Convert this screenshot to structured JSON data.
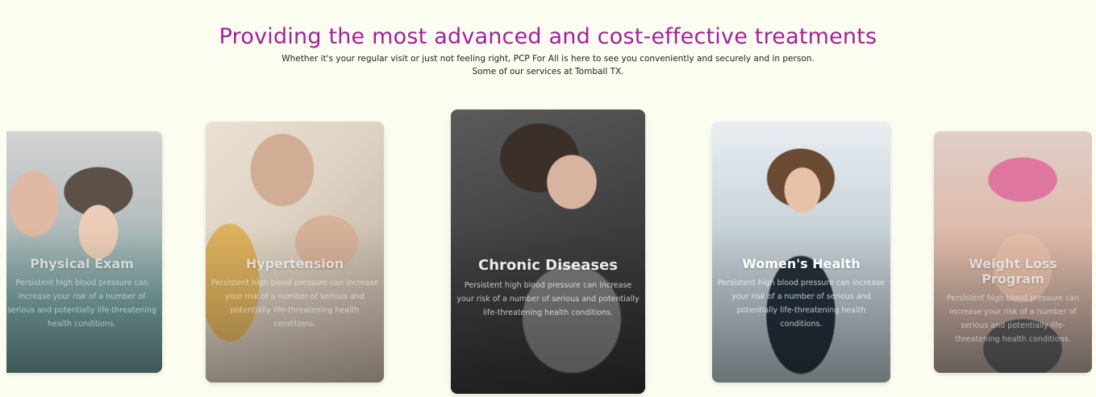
{
  "header": {
    "title": "Providing the most advanced and cost-effective treatments",
    "subtitle_line1": "Whether it's your regular visit or just not feeling right, PCP For All is here to see you conveniently and securely and in person.",
    "subtitle_line2": "Some of our services at Tomball TX."
  },
  "colors": {
    "title": "#a51f9c",
    "background": "#fbfdf0"
  },
  "cards": [
    {
      "title": "Physical Exam",
      "description": "Persistent high blood pressure can increase your risk of a number of serious and potentially life-threatening health conditions."
    },
    {
      "title": "Hypertension",
      "description": "Persistent high blood pressure can increase your risk of a number of serious and potentially life-threatening health conditions."
    },
    {
      "title": "Chronic Diseases",
      "description": "Persistent high blood pressure can increase your risk of a number of serious and potentially life-threatening health conditions."
    },
    {
      "title": "Women's Health",
      "description": "Persistent high blood pressure can increase your risk of a number of serious and potentially life-threatening health conditions."
    },
    {
      "title": "Weight Loss Program",
      "description": "Persistent high blood pressure can increase your risk of a number of serious and potentially life-threatening health conditions."
    }
  ]
}
